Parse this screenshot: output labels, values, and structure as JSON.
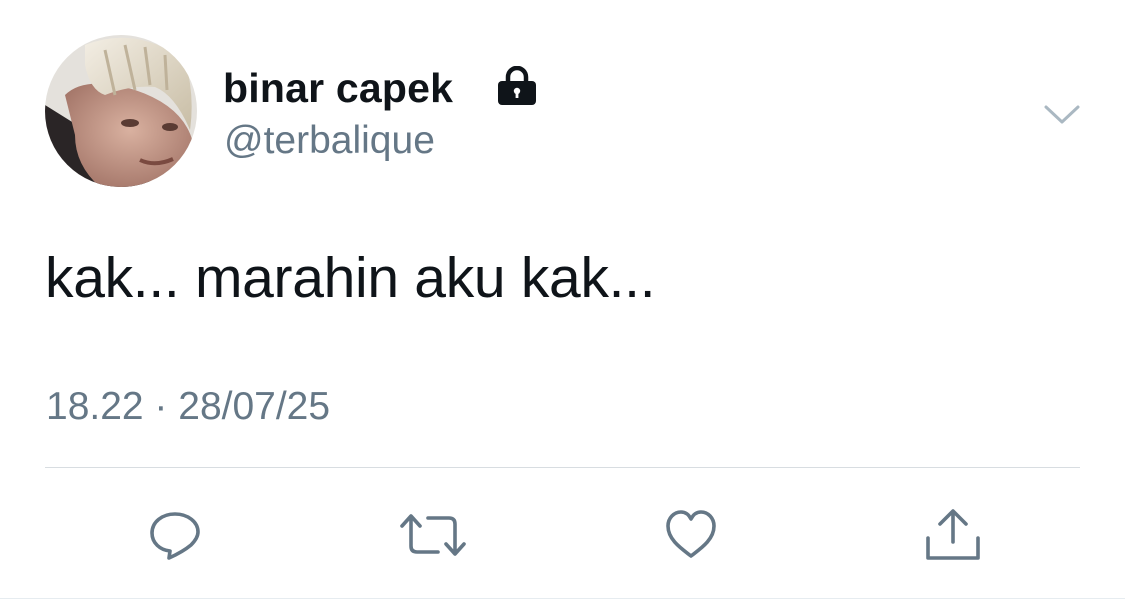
{
  "tweet": {
    "author": {
      "display_name": "binar capek",
      "handle": "@terbalique",
      "protected": true,
      "protected_icon": "lock-icon"
    },
    "text": "kak... marahin aku kak...",
    "timestamp": "18.22 · 28/07/25"
  },
  "menu_icon": "chevron-down-icon",
  "actions": [
    {
      "name": "reply",
      "icon": "reply-icon"
    },
    {
      "name": "retweet",
      "icon": "retweet-icon"
    },
    {
      "name": "like",
      "icon": "heart-icon"
    },
    {
      "name": "share",
      "icon": "share-icon"
    }
  ],
  "colors": {
    "text_primary": "#0f1419",
    "text_secondary": "#657786",
    "icon": "#657786",
    "divider": "#d8dde1",
    "background": "#ffffff"
  }
}
